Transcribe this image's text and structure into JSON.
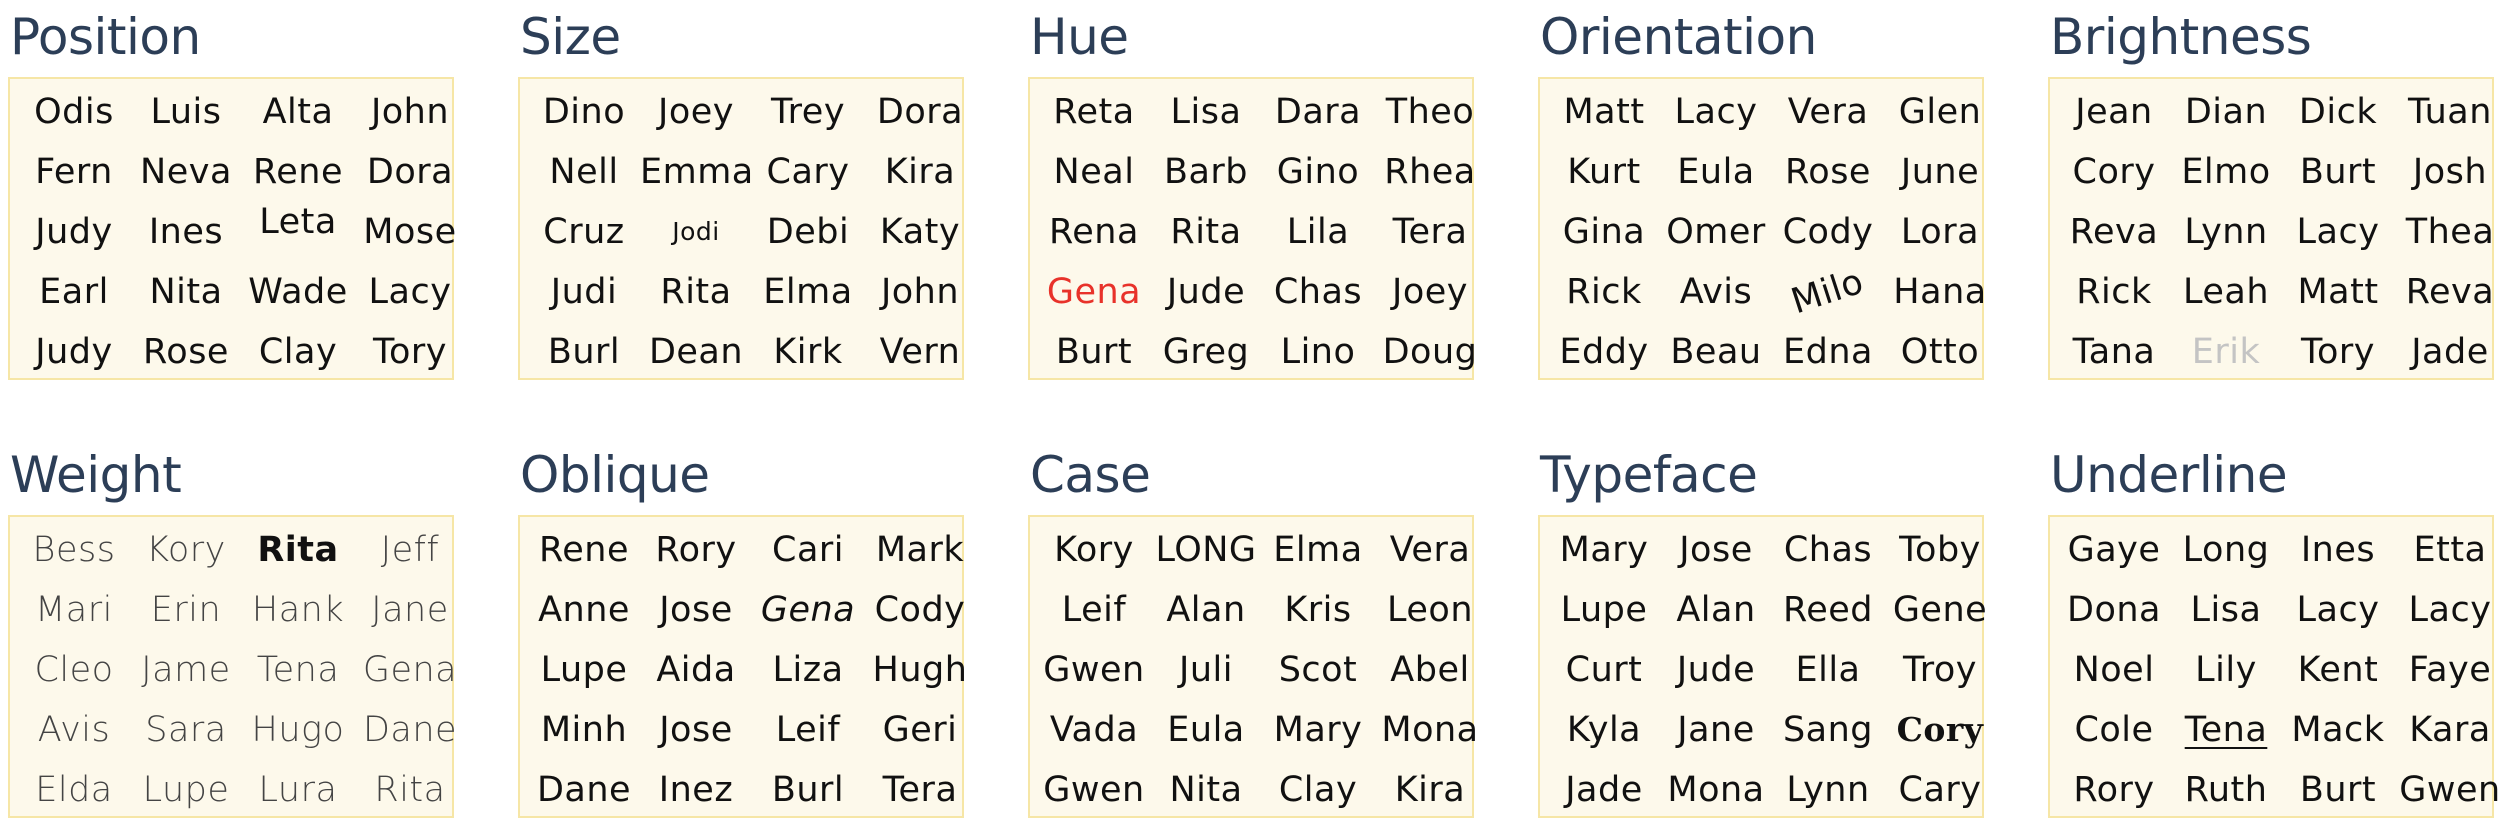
{
  "colors": {
    "title": "#2c3e57",
    "panel_background": "#fdf9eb",
    "panel_border": "#f6e6a6",
    "text": "#111111",
    "hue_highlight": "#e8322a",
    "brightness_faded": "#c4c4c4"
  },
  "panels": [
    {
      "title": "Position",
      "names": [
        [
          "Odis",
          "Luis",
          "Alta",
          "John"
        ],
        [
          "Fern",
          "Neva",
          "Rene",
          "Dora"
        ],
        [
          "Judy",
          "Ines",
          "Leta",
          "Mose"
        ],
        [
          "Earl",
          "Nita",
          "Wade",
          "Lacy"
        ],
        [
          "Judy",
          "Rose",
          "Clay",
          "Tory"
        ]
      ],
      "odd_one_out": {
        "row": 2,
        "col": 2,
        "name": "Leta",
        "variation": "shifted up"
      }
    },
    {
      "title": "Size",
      "names": [
        [
          "Dino",
          "Joey",
          "Trey",
          "Dora"
        ],
        [
          "Nell",
          "Emma",
          "Cary",
          "Kira"
        ],
        [
          "Cruz",
          "Jodi",
          "Debi",
          "Katy"
        ],
        [
          "Judi",
          "Rita",
          "Elma",
          "John"
        ],
        [
          "Burl",
          "Dean",
          "Kirk",
          "Vern"
        ]
      ],
      "odd_one_out": {
        "row": 2,
        "col": 1,
        "name": "Jodi",
        "variation": "smaller"
      }
    },
    {
      "title": "Hue",
      "names": [
        [
          "Reta",
          "Lisa",
          "Dara",
          "Theo"
        ],
        [
          "Neal",
          "Barb",
          "Gino",
          "Rhea"
        ],
        [
          "Rena",
          "Rita",
          "Lila",
          "Tera"
        ],
        [
          "Gena",
          "Jude",
          "Chas",
          "Joey"
        ],
        [
          "Burt",
          "Greg",
          "Lino",
          "Doug"
        ]
      ],
      "odd_one_out": {
        "row": 3,
        "col": 0,
        "name": "Gena",
        "variation": "red"
      }
    },
    {
      "title": "Orientation",
      "names": [
        [
          "Matt",
          "Lacy",
          "Vera",
          "Glen"
        ],
        [
          "Kurt",
          "Eula",
          "Rose",
          "June"
        ],
        [
          "Gina",
          "Omer",
          "Cody",
          "Lora"
        ],
        [
          "Rick",
          "Avis",
          "Milo",
          "Hana"
        ],
        [
          "Eddy",
          "Beau",
          "Edna",
          "Otto"
        ]
      ],
      "odd_one_out": {
        "row": 3,
        "col": 2,
        "name": "Milo",
        "variation": "rotated"
      }
    },
    {
      "title": "Brightness",
      "names": [
        [
          "Jean",
          "Dian",
          "Dick",
          "Tuan"
        ],
        [
          "Cory",
          "Elmo",
          "Burt",
          "Josh"
        ],
        [
          "Reva",
          "Lynn",
          "Lacy",
          "Thea"
        ],
        [
          "Rick",
          "Leah",
          "Matt",
          "Reva"
        ],
        [
          "Tana",
          "Erik",
          "Tory",
          "Jade"
        ]
      ],
      "odd_one_out": {
        "row": 4,
        "col": 1,
        "name": "Erik",
        "variation": "light gray"
      }
    },
    {
      "title": "Weight",
      "names": [
        [
          "Bess",
          "Kory",
          "Rita",
          "Jeff"
        ],
        [
          "Mari",
          "Erin",
          "Hank",
          "Jane"
        ],
        [
          "Cleo",
          "Jame",
          "Tena",
          "Gena"
        ],
        [
          "Avis",
          "Sara",
          "Hugo",
          "Dane"
        ],
        [
          "Elda",
          "Lupe",
          "Lura",
          "Rita"
        ]
      ],
      "odd_one_out": {
        "row": 0,
        "col": 2,
        "name": "Rita",
        "variation": "bold"
      }
    },
    {
      "title": "Oblique",
      "names": [
        [
          "Rene",
          "Rory",
          "Cari",
          "Mark"
        ],
        [
          "Anne",
          "Jose",
          "Gena",
          "Cody"
        ],
        [
          "Lupe",
          "Aida",
          "Liza",
          "Hugh"
        ],
        [
          "Minh",
          "Jose",
          "Leif",
          "Geri"
        ],
        [
          "Dane",
          "Inez",
          "Burl",
          "Tera"
        ]
      ],
      "odd_one_out": {
        "row": 1,
        "col": 2,
        "name": "Gena",
        "variation": "italic"
      }
    },
    {
      "title": "Case",
      "names": [
        [
          "Kory",
          "LONG",
          "Elma",
          "Vera"
        ],
        [
          "Leif",
          "Alan",
          "Kris",
          "Leon"
        ],
        [
          "Gwen",
          "Juli",
          "Scot",
          "Abel"
        ],
        [
          "Vada",
          "Eula",
          "Mary",
          "Mona"
        ],
        [
          "Gwen",
          "Nita",
          "Clay",
          "Kira"
        ]
      ],
      "odd_one_out": {
        "row": 0,
        "col": 1,
        "name": "LONG",
        "variation": "uppercase"
      }
    },
    {
      "title": "Typeface",
      "names": [
        [
          "Mary",
          "Jose",
          "Chas",
          "Toby"
        ],
        [
          "Lupe",
          "Alan",
          "Reed",
          "Gene"
        ],
        [
          "Curt",
          "Jude",
          "Ella",
          "Troy"
        ],
        [
          "Kyla",
          "Jane",
          "Sang",
          "Cory"
        ],
        [
          "Jade",
          "Mona",
          "Lynn",
          "Cary"
        ]
      ],
      "odd_one_out": {
        "row": 3,
        "col": 3,
        "name": "Cory",
        "variation": "blackletter"
      }
    },
    {
      "title": "Underline",
      "names": [
        [
          "Gaye",
          "Long",
          "Ines",
          "Etta"
        ],
        [
          "Dona",
          "Lisa",
          "Lacy",
          "Lacy"
        ],
        [
          "Noel",
          "Lily",
          "Kent",
          "Faye"
        ],
        [
          "Cole",
          "Tena",
          "Mack",
          "Kara"
        ],
        [
          "Rory",
          "Ruth",
          "Burt",
          "Gwen"
        ]
      ],
      "odd_one_out": {
        "row": 3,
        "col": 1,
        "name": "Tena",
        "variation": "underlined"
      }
    }
  ]
}
